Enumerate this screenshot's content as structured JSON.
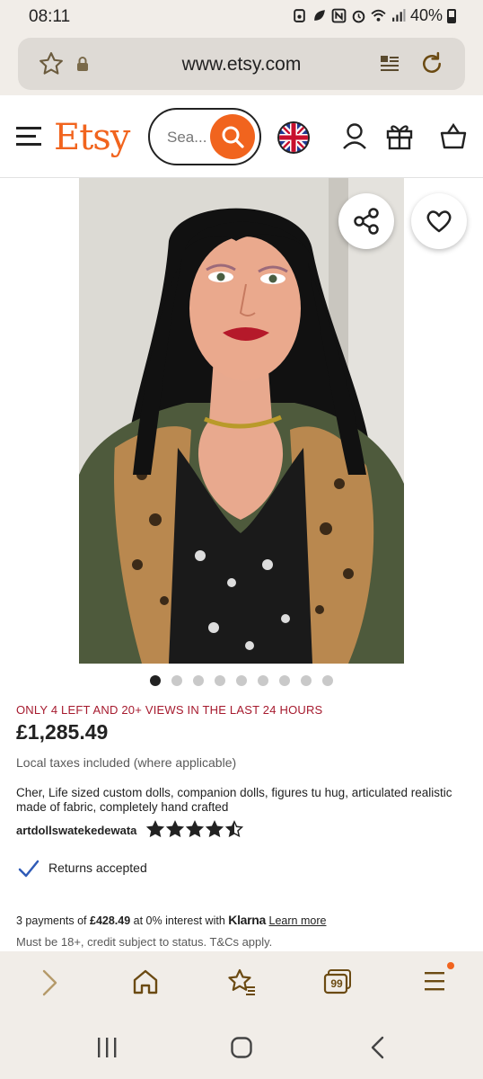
{
  "status_bar": {
    "time": "08:11",
    "battery": "40%"
  },
  "browser": {
    "url": "www.etsy.com",
    "tabs_count": "99"
  },
  "header": {
    "logo": "Etsy",
    "search_placeholder": "Sea..."
  },
  "product": {
    "carousel_total": 9,
    "carousel_index": 1,
    "scarcity": "ONLY 4 LEFT AND 20+ VIEWS IN THE LAST 24 HOURS",
    "price": "£1,285.49",
    "taxes": "Local taxes included (where applicable)",
    "title": "Cher, Life sized custom dolls, companion dolls, figures tu hug, articulated realistic made of fabric, completely hand crafted",
    "seller": "artdollswatekedewata",
    "rating": 4.5,
    "returns": "Returns accepted",
    "klarna": {
      "prefix": "3 payments of ",
      "amount": "£428.49",
      "middle": " at 0% interest with ",
      "brand": "Klarna",
      "link": "Learn more"
    },
    "legal": "Must be 18+, credit subject to status. T&Cs apply."
  },
  "colors": {
    "brand": "#f1641e",
    "scarcity": "#a61a2e",
    "chrome": "#f1ede8"
  },
  "icons": [
    "star-icon",
    "lock-icon",
    "reader-icon",
    "reload-icon",
    "menu-icon",
    "search-icon",
    "uk-flag-icon",
    "account-icon",
    "gift-icon",
    "cart-icon",
    "share-icon",
    "heart-icon",
    "check-icon",
    "forward-icon",
    "home-icon",
    "bookmarks-icon",
    "tabs-icon",
    "more-icon",
    "recents-icon",
    "home-nav-icon",
    "back-nav-icon"
  ]
}
